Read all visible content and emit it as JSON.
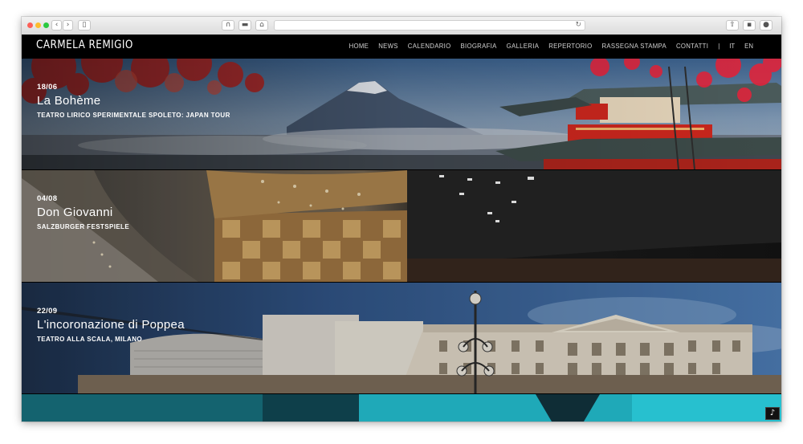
{
  "site": {
    "logo": "CARMELA REMIGIO"
  },
  "nav": {
    "items": [
      "HOME",
      "NEWS",
      "CALENDARIO",
      "BIOGRAFIA",
      "GALLERIA",
      "REPERTORIO",
      "RASSEGNA STAMPA",
      "CONTATTI"
    ],
    "separator": "|",
    "languages": [
      "IT",
      "EN"
    ]
  },
  "events": [
    {
      "date": "18/06",
      "title": "La Bohème",
      "venue": "TEATRO LIRICO SPERIMENTALE SPOLETO: JAPAN TOUR"
    },
    {
      "date": "04/08",
      "title": "Don Giovanni",
      "venue": "SALZBURGER FESTSPIELE"
    },
    {
      "date": "22/09",
      "title": "L'incoronazione di Poppea",
      "venue": "TEATRO ALLA SCALA, MILANO"
    }
  ],
  "icons": {
    "back": "chevron-left-icon",
    "forward": "chevron-right-icon",
    "sidebar": "sidebar-icon",
    "reload": "reload-icon",
    "share": "share-icon",
    "music": "music-note-icon"
  },
  "colors": {
    "header_bg": "#000000",
    "nav_text": "#d2d2d2",
    "pagoda_red": "#c8261d",
    "sky_blue": "#3f6ea3",
    "teal": "#1fa9b8"
  }
}
